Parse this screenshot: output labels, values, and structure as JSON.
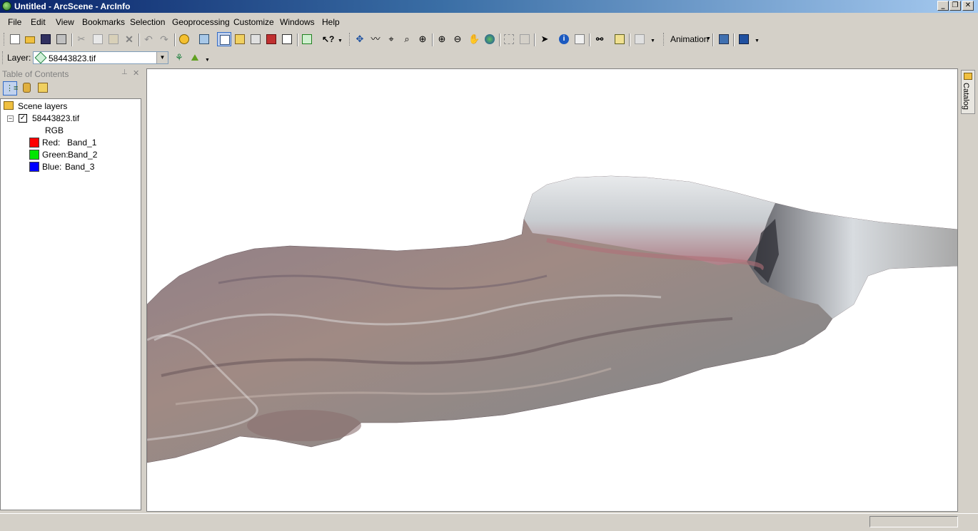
{
  "window": {
    "title": "Untitled - ArcScene - ArcInfo",
    "buttons": [
      "_",
      "❐",
      "✕"
    ]
  },
  "menu": [
    "File",
    "Edit",
    "View",
    "Bookmarks",
    "Selection",
    "Geoprocessing",
    "Customize",
    "Windows",
    "Help"
  ],
  "toolbar": {
    "animation_label": "Animation",
    "layer_label": "Layer:",
    "layer_value": "58443823.tif"
  },
  "toc": {
    "title": "Table of Contents",
    "root": "Scene layers",
    "layer": "58443823.tif",
    "renderer": "RGB",
    "bands": [
      {
        "channel": "Red:",
        "band": "Band_1",
        "color": "#ff0000"
      },
      {
        "channel": "Green:",
        "band": "Band_2",
        "color": "#00e600"
      },
      {
        "channel": "Blue:",
        "band": "Band_3",
        "color": "#0000ff"
      }
    ]
  },
  "catalog_tab": "Catalog",
  "colors": {
    "titlebar_start": "#0a246a",
    "titlebar_end": "#a6caf0",
    "chrome": "#d4d0c8",
    "toolbar_active": "#c1d2ee"
  }
}
